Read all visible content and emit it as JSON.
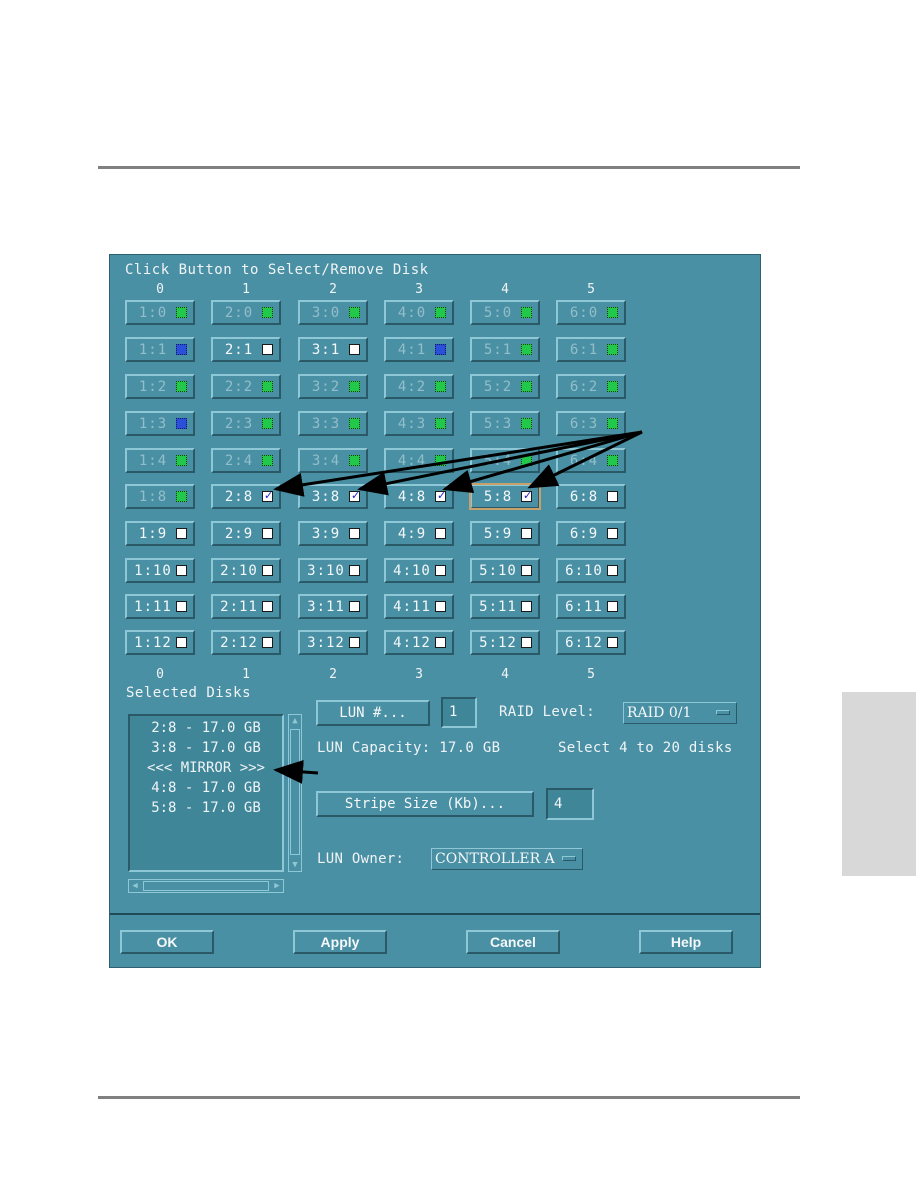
{
  "dialog": {
    "title": "Click Button to Select/Remove Disk",
    "columns": [
      "0",
      "1",
      "2",
      "3",
      "4",
      "5"
    ],
    "rows": [
      {
        "cells": [
          {
            "label": "1:0",
            "state": "used-green",
            "enabled": false
          },
          {
            "label": "2:0",
            "state": "used-green",
            "enabled": false
          },
          {
            "label": "3:0",
            "state": "used-green",
            "enabled": false
          },
          {
            "label": "4:0",
            "state": "used-green",
            "enabled": false
          },
          {
            "label": "5:0",
            "state": "used-green",
            "enabled": false
          },
          {
            "label": "6:0",
            "state": "used-green",
            "enabled": false
          }
        ]
      },
      {
        "cells": [
          {
            "label": "1:1",
            "state": "used-blue",
            "enabled": false
          },
          {
            "label": "2:1",
            "state": "free",
            "enabled": true
          },
          {
            "label": "3:1",
            "state": "free",
            "enabled": true
          },
          {
            "label": "4:1",
            "state": "used-blue",
            "enabled": false
          },
          {
            "label": "5:1",
            "state": "used-green",
            "enabled": false
          },
          {
            "label": "6:1",
            "state": "used-green",
            "enabled": false
          }
        ]
      },
      {
        "cells": [
          {
            "label": "1:2",
            "state": "used-green",
            "enabled": false
          },
          {
            "label": "2:2",
            "state": "used-green",
            "enabled": false
          },
          {
            "label": "3:2",
            "state": "used-green",
            "enabled": false
          },
          {
            "label": "4:2",
            "state": "used-green",
            "enabled": false
          },
          {
            "label": "5:2",
            "state": "used-green",
            "enabled": false
          },
          {
            "label": "6:2",
            "state": "used-green",
            "enabled": false
          }
        ]
      },
      {
        "cells": [
          {
            "label": "1:3",
            "state": "used-blue",
            "enabled": false
          },
          {
            "label": "2:3",
            "state": "used-green",
            "enabled": false
          },
          {
            "label": "3:3",
            "state": "used-green",
            "enabled": false
          },
          {
            "label": "4:3",
            "state": "used-green",
            "enabled": false
          },
          {
            "label": "5:3",
            "state": "used-green",
            "enabled": false
          },
          {
            "label": "6:3",
            "state": "used-green",
            "enabled": false
          }
        ]
      },
      {
        "cells": [
          {
            "label": "1:4",
            "state": "used-green",
            "enabled": false
          },
          {
            "label": "2:4",
            "state": "used-green",
            "enabled": false
          },
          {
            "label": "3:4",
            "state": "used-green",
            "enabled": false
          },
          {
            "label": "4:4",
            "state": "used-green",
            "enabled": false
          },
          {
            "label": "5:4",
            "state": "used-green",
            "enabled": false
          },
          {
            "label": "6:4",
            "state": "used-green",
            "enabled": false
          }
        ]
      },
      {
        "cells": [
          {
            "label": "1:8",
            "state": "used-green",
            "enabled": false
          },
          {
            "label": "2:8",
            "state": "checked",
            "enabled": true
          },
          {
            "label": "3:8",
            "state": "checked",
            "enabled": true
          },
          {
            "label": "4:8",
            "state": "checked",
            "enabled": true
          },
          {
            "label": "5:8",
            "state": "checked",
            "enabled": true,
            "focused": true
          },
          {
            "label": "6:8",
            "state": "free",
            "enabled": true
          }
        ]
      },
      {
        "cells": [
          {
            "label": "1:9",
            "state": "free",
            "enabled": true
          },
          {
            "label": "2:9",
            "state": "free",
            "enabled": true
          },
          {
            "label": "3:9",
            "state": "free",
            "enabled": true
          },
          {
            "label": "4:9",
            "state": "free",
            "enabled": true
          },
          {
            "label": "5:9",
            "state": "free",
            "enabled": true
          },
          {
            "label": "6:9",
            "state": "free",
            "enabled": true
          }
        ]
      },
      {
        "cells": [
          {
            "label": "1:10",
            "state": "free",
            "enabled": true
          },
          {
            "label": "2:10",
            "state": "free",
            "enabled": true
          },
          {
            "label": "3:10",
            "state": "free",
            "enabled": true
          },
          {
            "label": "4:10",
            "state": "free",
            "enabled": true
          },
          {
            "label": "5:10",
            "state": "free",
            "enabled": true
          },
          {
            "label": "6:10",
            "state": "free",
            "enabled": true
          }
        ]
      },
      {
        "cells": [
          {
            "label": "1:11",
            "state": "free",
            "enabled": true
          },
          {
            "label": "2:11",
            "state": "free",
            "enabled": true
          },
          {
            "label": "3:11",
            "state": "free",
            "enabled": true
          },
          {
            "label": "4:11",
            "state": "free",
            "enabled": true
          },
          {
            "label": "5:11",
            "state": "free",
            "enabled": true
          },
          {
            "label": "6:11",
            "state": "free",
            "enabled": true
          }
        ]
      },
      {
        "cells": [
          {
            "label": "1:12",
            "state": "free",
            "enabled": true
          },
          {
            "label": "2:12",
            "state": "free",
            "enabled": true
          },
          {
            "label": "3:12",
            "state": "free",
            "enabled": true
          },
          {
            "label": "4:12",
            "state": "free",
            "enabled": true
          },
          {
            "label": "5:12",
            "state": "free",
            "enabled": true
          },
          {
            "label": "6:12",
            "state": "free",
            "enabled": true
          }
        ]
      }
    ],
    "selected_disks": {
      "label": "Selected Disks",
      "items": [
        "2:8 - 17.0 GB",
        "3:8 - 17.0 GB",
        "<<< MIRROR >>>",
        "4:8 - 17.0 GB",
        "5:8 - 17.0 GB"
      ]
    },
    "lun": {
      "button_label": "LUN #...",
      "value": "1"
    },
    "raid": {
      "label": "RAID Level:",
      "selected": "RAID 0/1"
    },
    "capacity": "LUN Capacity: 17.0 GB",
    "hint": "Select 4 to 20 disks",
    "stripe": {
      "button_label": "Stripe Size (Kb)...",
      "value": "4"
    },
    "owner": {
      "label": "LUN Owner:",
      "selected": "CONTROLLER A"
    },
    "footer": {
      "ok": "OK",
      "apply": "Apply",
      "cancel": "Cancel",
      "help": "Help"
    }
  },
  "colors": {
    "dialog_bg": "#4a90a4",
    "used_green": "#22c84a",
    "used_blue": "#2a4fd8",
    "check_mark": "#2020d0",
    "focus_outline": "#c8a06a"
  }
}
